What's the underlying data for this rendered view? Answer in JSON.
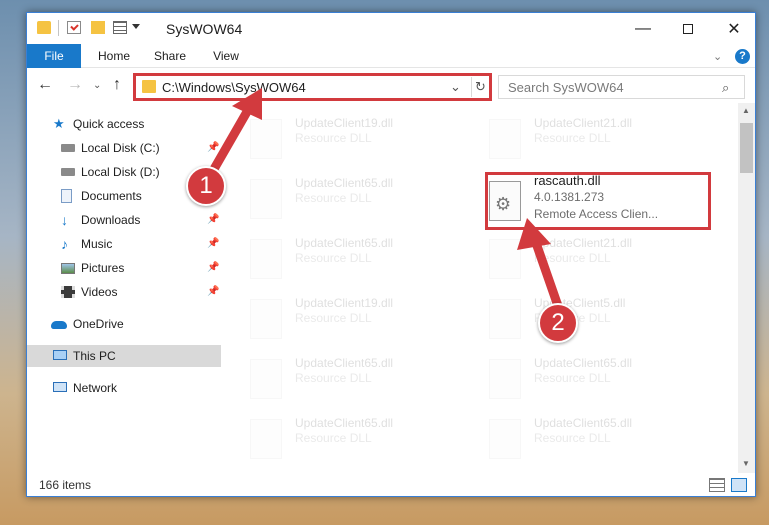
{
  "window": {
    "title": "SysWOW64",
    "minimize_glyph": "—",
    "close_glyph": "✕"
  },
  "ribbon": {
    "tabs": [
      "File",
      "Home",
      "Share",
      "View"
    ],
    "help": "?"
  },
  "nav": {
    "back": "←",
    "forward": "→",
    "recent": "⌄",
    "up": "↑",
    "address": "C:\\Windows\\SysWOW64",
    "address_dropdown": "⌄",
    "refresh": "↻"
  },
  "search": {
    "placeholder": "Search SysWOW64",
    "icon": "⌕"
  },
  "sidebar": {
    "items": [
      {
        "label": "Quick access",
        "icon": "star-icon",
        "pinned": false
      },
      {
        "label": "Local Disk (C:)",
        "icon": "drive-icon",
        "pinned": true
      },
      {
        "label": "Local Disk (D:)",
        "icon": "drive-icon",
        "pinned": true
      },
      {
        "label": "Documents",
        "icon": "documents-icon",
        "pinned": true
      },
      {
        "label": "Downloads",
        "icon": "download-icon",
        "pinned": true
      },
      {
        "label": "Music",
        "icon": "music-icon",
        "pinned": true
      },
      {
        "label": "Pictures",
        "icon": "pictures-icon",
        "pinned": true
      },
      {
        "label": "Videos",
        "icon": "videos-icon",
        "pinned": true
      },
      {
        "label": "OneDrive",
        "icon": "cloud-icon",
        "pinned": false
      },
      {
        "label": "This PC",
        "icon": "computer-icon",
        "pinned": false,
        "selected": true
      },
      {
        "label": "Network",
        "icon": "network-icon",
        "pinned": false
      }
    ],
    "pin_glyph": "📌"
  },
  "files": {
    "faded": [
      {
        "name": "UpdateClient19.dll",
        "desc": "Resource DLL"
      },
      {
        "name": "UpdateClient21.dll",
        "desc": "Resource DLL"
      },
      {
        "name": "UpdateClient65.dll",
        "desc": "Resource DLL"
      },
      {
        "name": "UpdateClient65.dll",
        "desc": "Resource DLL"
      },
      {
        "name": "UpdateClient21.dll",
        "desc": "Resource DLL"
      },
      {
        "name": "UpdateClient19.dll",
        "desc": "Resource DLL"
      },
      {
        "name": "UpdateClient5.dll",
        "desc": "Resource DLL"
      },
      {
        "name": "UpdateClient65.dll",
        "desc": "Resource DLL"
      },
      {
        "name": "UpdateClient65.dll",
        "desc": "Resource DLL"
      },
      {
        "name": "UpdateClient65.dll",
        "desc": "Resource DLL"
      },
      {
        "name": "UpdateClient65.dll",
        "desc": "Resource DLL"
      }
    ],
    "highlighted": {
      "name": "rascauth.dll",
      "version": "4.0.1381.273",
      "description": "Remote Access Clien..."
    }
  },
  "status": {
    "count": "166 items"
  },
  "annotations": {
    "step1": "1",
    "step2": "2",
    "color": "#d23a3e"
  }
}
